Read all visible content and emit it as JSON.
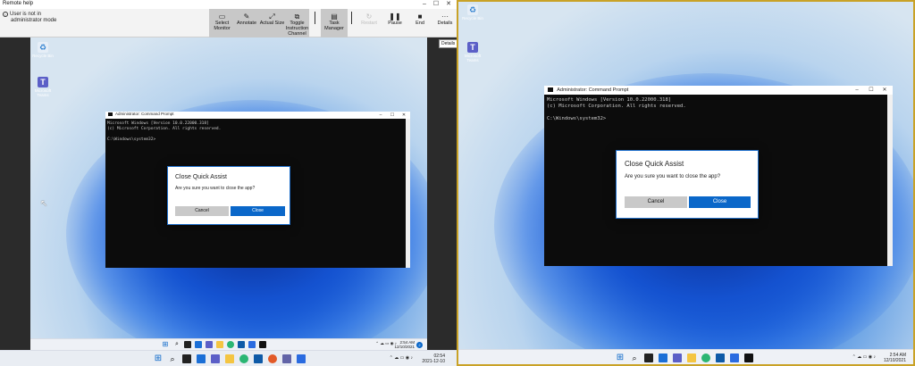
{
  "remote_help": {
    "title": "Remote help",
    "window_controls": {
      "minimize": "–",
      "maximize": "☐",
      "close": "✕"
    },
    "admin_notice": {
      "line1": "User is not in",
      "line2": "administrator mode"
    },
    "toolbar": {
      "select_monitor": "Select Monitor",
      "annotate": "Annotate",
      "actual_size": "Actual Size",
      "toggle_instruction_channel": "Toggle Instruction Channel",
      "task_manager": "Task Manager",
      "restart": "Restart",
      "pause": "Pause",
      "end": "End",
      "details": "Details"
    },
    "details_tooltip": "Details"
  },
  "desktop": {
    "recycle_bin": "Recycle Bin",
    "teams": "Microsoft Teams"
  },
  "cmd": {
    "title": "Administrator: Command Prompt",
    "line1": "Microsoft Windows [Version 10.0.22000.318]",
    "line2": "(c) Microsoft Corporation. All rights reserved.",
    "line3": "C:\\Windows\\system32>"
  },
  "dialog": {
    "title": "Close Quick Assist",
    "message": "Are you sure you want to close the app?",
    "cancel": "Cancel",
    "close": "Close"
  },
  "remote_taskbar": {
    "time": "2:54 AM",
    "date": "12/10/2021"
  },
  "local_taskbar": {
    "time": "02:54",
    "date": "2021-12-10"
  },
  "right_taskbar": {
    "time": "2:54 AM",
    "date": "12/10/2021"
  },
  "colors": {
    "accent": "#0a67c9",
    "monitor_border": "#c9a227",
    "toolbar_group": "#c8c8c8"
  }
}
